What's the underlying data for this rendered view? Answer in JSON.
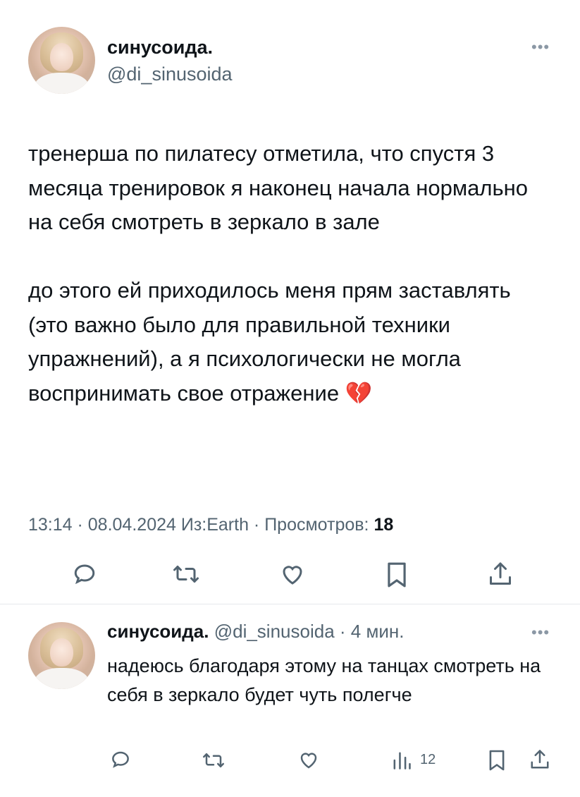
{
  "main_tweet": {
    "author_name": "синусоида.",
    "author_handle": "@di_sinusoida",
    "paragraphs": [
      "тренерша по пилатесу отметила, что спустя 3 месяца тренировок я наконец начала нормально на себя смотреть в зеркало в зале",
      "до этого ей приходилось меня прям заставлять (это важно было для правильной техники упражнений), а я психологически не могла воспринимать свое отражение 💔"
    ],
    "meta_text": "13:14 · 08.04.2024 Из:Earth · Просмотров: ",
    "views": "18",
    "more_icon": "more-icon",
    "actions": [
      "reply-icon",
      "retweet-icon",
      "like-icon",
      "bookmark-icon",
      "share-icon"
    ]
  },
  "reply_tweet": {
    "author_name": "синусоида.",
    "author_handle": "@di_sinusoida",
    "time_text": " · 4 мин.",
    "text": "надеюсь благодаря этому на танцах смотреть на себя в зеркало будет чуть полегче",
    "views": "12",
    "more_icon": "more-icon",
    "actions": [
      "reply-icon",
      "retweet-icon",
      "like-icon",
      "views-icon",
      "bookmark-icon",
      "share-icon"
    ]
  },
  "colors": {
    "text": "#0f1419",
    "secondary": "#536471",
    "icon": "#536471",
    "divider": "#e6e9ec"
  }
}
